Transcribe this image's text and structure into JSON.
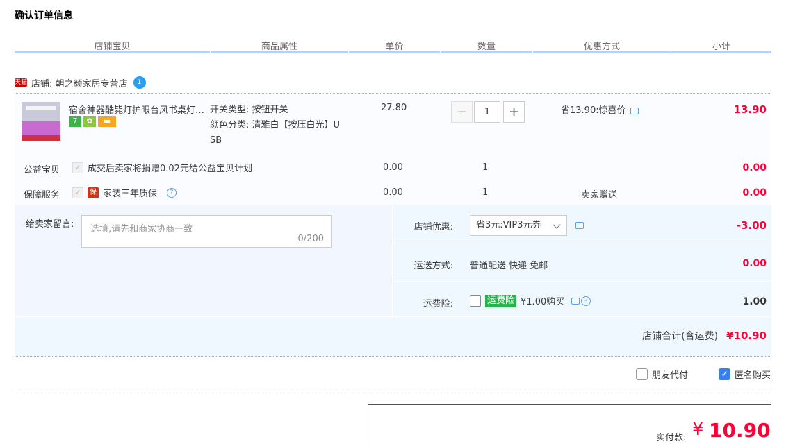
{
  "page_title": "确认订单信息",
  "columns": [
    "店铺宝贝",
    "商品属性",
    "单价",
    "数量",
    "优惠方式",
    "小计"
  ],
  "shop": {
    "badge": "天猫",
    "label": "店铺: 朝之颜家居专营店",
    "wangwang": "1"
  },
  "item": {
    "name": "宿舍神器酷毙灯护眼台风书桌灯…",
    "badges": [
      "7",
      "",
      ""
    ],
    "attr_line1": "开关类型: 按钮开关",
    "attr_line2": "颜色分类: 清雅白【按压白光】U",
    "attr_line3": "SB",
    "price": "27.80",
    "quantity": "1",
    "discount": "省13.90:惊喜价",
    "subtotal": "13.90"
  },
  "charity": {
    "label": "公益宝贝",
    "text": "成交后卖家将捐赠0.02元给公益宝贝计划",
    "price": "0.00",
    "qty": "1",
    "subtotal": "0.00"
  },
  "warranty": {
    "label": "保障服务",
    "badge": "保",
    "text": "家装三年质保",
    "price": "0.00",
    "qty": "1",
    "promo": "卖家赠送",
    "subtotal": "0.00"
  },
  "message": {
    "label": "给卖家留言:",
    "placeholder": "选填,请先和商家协商一致",
    "counter": "0/200"
  },
  "coupon": {
    "label": "店铺优惠:",
    "selected": "省3元:VIP3元券",
    "amount": "-3.00"
  },
  "shipping": {
    "label": "运送方式:",
    "value": "普通配送 快递 免邮",
    "amount": "0.00"
  },
  "insurance": {
    "label": "运费险:",
    "tag": "运费险",
    "text": "¥1.00购买",
    "amount": "1.00"
  },
  "shop_total": {
    "label": "店铺合计(含运费)",
    "value": "¥10.90"
  },
  "options": {
    "friend_pay": "朋友代付",
    "anonymous": "匿名购买"
  },
  "payment": {
    "label": "实付款:",
    "currency": "¥",
    "value": "10.90"
  },
  "colors": {
    "accent": "#ff0036",
    "header_line": "#b2d1ff",
    "checkbox_on": "#3a7ff2"
  }
}
